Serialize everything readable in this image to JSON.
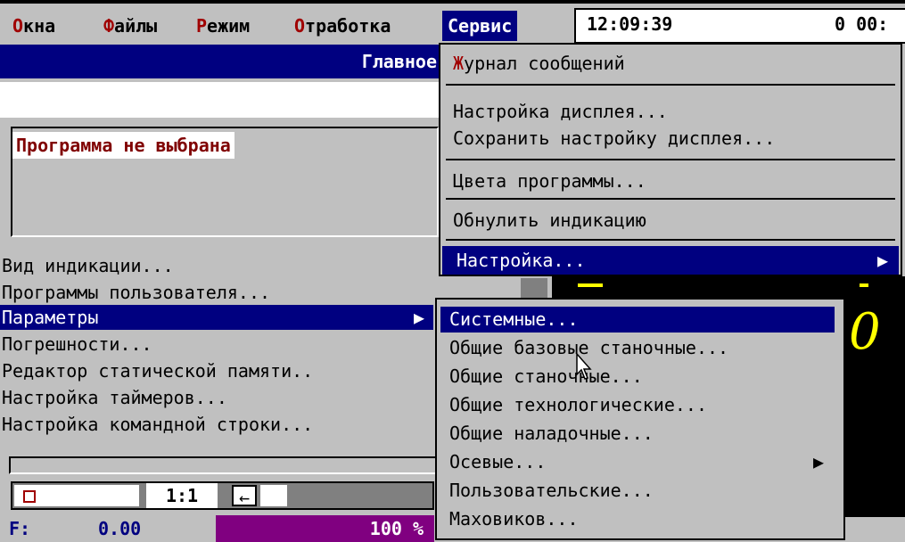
{
  "menubar": {
    "items": [
      {
        "hot": "О",
        "rest": "кна"
      },
      {
        "hot": "Ф",
        "rest": "айлы"
      },
      {
        "hot": "Р",
        "rest": "ежим"
      },
      {
        "hot": "О",
        "rest": "тработка"
      }
    ],
    "service_label": "Сервис",
    "time": "12:09:39",
    "time2": "0 00:"
  },
  "window": {
    "title": "Главное",
    "program_status": "Программа не выбрана"
  },
  "left_menu": [
    {
      "label": "Вид индикации...",
      "selected": false
    },
    {
      "label": "Программы пользователя...",
      "selected": false
    },
    {
      "label": "Параметры",
      "selected": true,
      "arrow": "▶"
    },
    {
      "label": "Погрешности...",
      "selected": false
    },
    {
      "label": "Редактор статической памяти..",
      "selected": false
    },
    {
      "label": "Настройка таймеров...",
      "selected": false
    },
    {
      "label": "Настройка командной строки...",
      "selected": false
    }
  ],
  "service_menu": {
    "journal_hot": "Ж",
    "journal_rest": "урнал сообщений",
    "display_setup": "Настройка дисплея...",
    "save_display": "Сохранить настройку дисплея...",
    "colors": "Цвета программы...",
    "reset": "Обнулить индикацию",
    "setup": "Настройка...",
    "setup_arrow": "▶"
  },
  "submenu": [
    {
      "label": "Системные...",
      "selected": true
    },
    {
      "label": "Общие базовые станочные...",
      "selected": false
    },
    {
      "label": "Общие станочные...",
      "selected": false
    },
    {
      "label": "Общие технологические...",
      "selected": false
    },
    {
      "label": "Общие наладочные...",
      "selected": false
    },
    {
      "label": "Осевые...",
      "selected": false,
      "arrow": "▶"
    },
    {
      "label": "Пользовательские...",
      "selected": false
    },
    {
      "label": "Маховиков...",
      "selected": false
    }
  ],
  "status": {
    "zoom": "1:1",
    "zoom_arrow": "←",
    "feed_label": "F:",
    "feed_value": "0.00",
    "percent": "100 %"
  },
  "display": {
    "digits": "0"
  }
}
